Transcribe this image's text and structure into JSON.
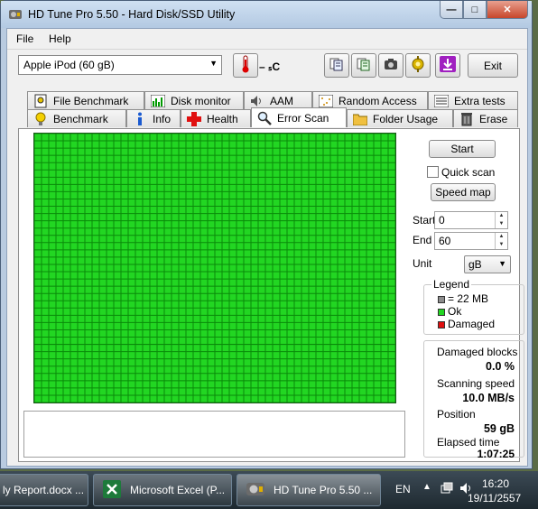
{
  "window": {
    "title": "HD Tune Pro 5.50 - Hard Disk/SSD Utility",
    "minimize_glyph": "—",
    "maximize_glyph": "□",
    "close_glyph": "✕"
  },
  "menu": {
    "file": "File",
    "help": "Help"
  },
  "toolbar": {
    "drive": "Apple   iPod (60 gB)",
    "temperature": "– ₛC",
    "exit_label": "Exit"
  },
  "tabs_row1": [
    {
      "label": "File Benchmark",
      "icon": "file-benchmark-icon"
    },
    {
      "label": "Disk monitor",
      "icon": "disk-monitor-icon"
    },
    {
      "label": "AAM",
      "icon": "speaker-icon"
    },
    {
      "label": "Random Access",
      "icon": "random-access-icon"
    },
    {
      "label": "Extra tests",
      "icon": "extra-tests-icon"
    }
  ],
  "tabs_row2": [
    {
      "label": "Benchmark",
      "icon": "lightbulb-icon"
    },
    {
      "label": "Info",
      "icon": "info-icon"
    },
    {
      "label": "Health",
      "icon": "health-cross-icon"
    },
    {
      "label": "Error Scan",
      "icon": "magnifier-icon",
      "active": true
    },
    {
      "label": "Folder Usage",
      "icon": "folder-icon"
    },
    {
      "label": "Erase",
      "icon": "trash-icon"
    }
  ],
  "scan": {
    "start_button": "Start",
    "quick_scan_label": "Quick scan",
    "quick_scan_checked": false,
    "speed_map_button": "Speed map",
    "start_label": "Start",
    "start_value": "0",
    "end_label": "End",
    "end_value": "60",
    "unit_label": "Unit",
    "unit_value": "gB",
    "grid_block_color": "#22d622",
    "grid_border_color": "#0a8a0a"
  },
  "legend": {
    "title": "Legend",
    "items": [
      {
        "label": "= 22 MB",
        "color": "#8c8c8c"
      },
      {
        "label": "Ok",
        "color": "#22d622"
      },
      {
        "label": "Damaged",
        "color": "#e01010"
      }
    ]
  },
  "stats": {
    "damaged_blocks_label": "Damaged blocks",
    "damaged_blocks_value": "0.0 %",
    "scanning_speed_label": "Scanning speed",
    "scanning_speed_value": "10.0 MB/s",
    "position_label": "Position",
    "position_value": "59 gB",
    "elapsed_label": "Elapsed time",
    "elapsed_value": "1:07:25"
  },
  "taskbar": {
    "items": [
      {
        "label": "ly Report.docx ...",
        "icon": "word-icon"
      },
      {
        "label": "Microsoft Excel (P...",
        "icon": "excel-icon"
      },
      {
        "label": "HD Tune Pro 5.50 ...",
        "icon": "hdtune-icon",
        "active": true
      }
    ],
    "language": "EN",
    "time": "16:20",
    "date": "19/11/2557"
  }
}
